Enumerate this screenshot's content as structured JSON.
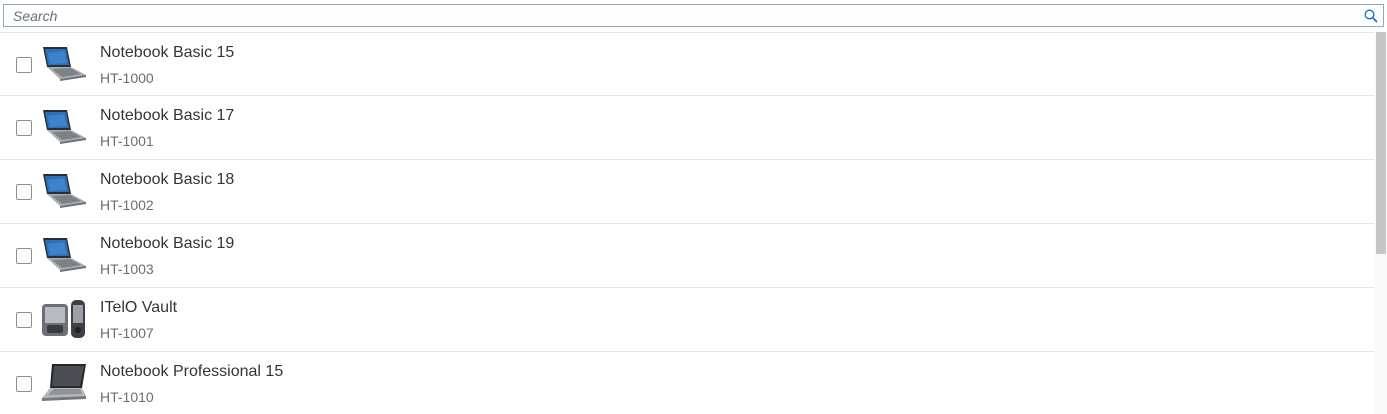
{
  "search": {
    "placeholder": "Search",
    "value": ""
  },
  "items": [
    {
      "title": "Notebook Basic 15",
      "id": "HT-1000",
      "icon": "notebook-basic-icon"
    },
    {
      "title": "Notebook Basic 17",
      "id": "HT-1001",
      "icon": "notebook-basic-icon"
    },
    {
      "title": "Notebook Basic 18",
      "id": "HT-1002",
      "icon": "notebook-basic-icon"
    },
    {
      "title": "Notebook Basic 19",
      "id": "HT-1003",
      "icon": "notebook-basic-icon"
    },
    {
      "title": "ITelO Vault",
      "id": "HT-1007",
      "icon": "pda-device-icon"
    },
    {
      "title": "Notebook Professional 15",
      "id": "HT-1010",
      "icon": "notebook-professional-icon"
    }
  ],
  "colors": {
    "border": "#e5e5e5",
    "search_border": "#8fa7c4",
    "accent": "#0a6ed1"
  }
}
